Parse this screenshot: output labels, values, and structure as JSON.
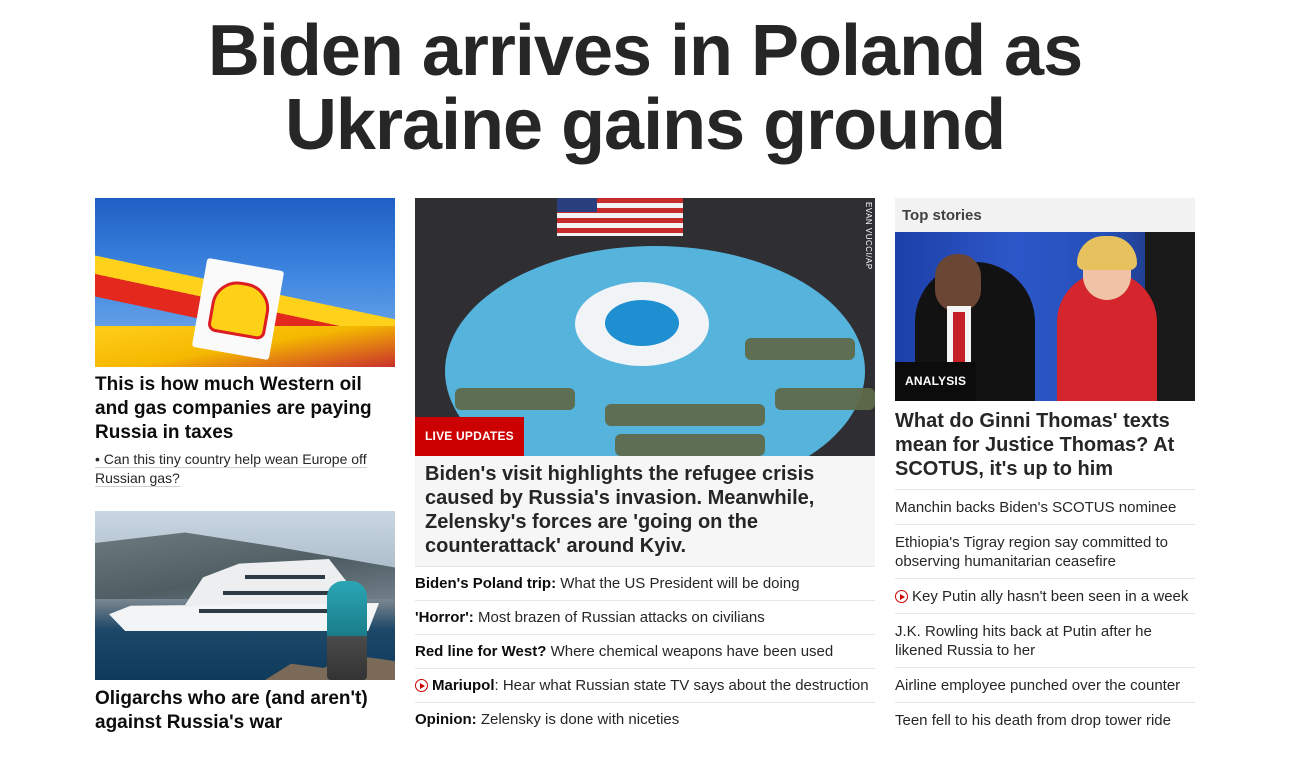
{
  "headline": "Biden arrives in Poland as Ukraine gains ground",
  "left": {
    "story1": {
      "title": "This is how much Western oil and gas companies are paying Russia in taxes",
      "related": "• Can this tiny country help wean Europe off Russian gas?"
    },
    "story2": {
      "title": "Oligarchs who are (and aren't) against Russia's war"
    }
  },
  "middle": {
    "photo_credit": "EVAN VUCCI/AP",
    "label": "LIVE UPDATES",
    "title": "Biden's visit highlights the refugee crisis caused by Russia's invasion. Meanwhile, Zelensky's forces are 'going on the counterattack' around Kyiv.",
    "links": [
      {
        "bold": "Biden's Poland trip:",
        "text": " What the US President will be doing",
        "video": false
      },
      {
        "bold": "'Horror':",
        "text": " Most brazen of Russian attacks on civilians",
        "video": false
      },
      {
        "bold": "Red line for West?",
        "text": " Where chemical weapons have been used",
        "video": false
      },
      {
        "bold": "Mariupol",
        "text": ": Hear what Russian state TV says about the destruction",
        "video": true
      },
      {
        "bold": "Opinion:",
        "text": " Zelensky is done with niceties",
        "video": false
      }
    ]
  },
  "right": {
    "section_title": "Top stories",
    "label": "ANALYSIS",
    "title": "What do Ginni Thomas' texts mean for Justice Thomas? At SCOTUS, it's up to him",
    "links": [
      {
        "text": "Manchin backs Biden's SCOTUS nominee",
        "video": false
      },
      {
        "text": "Ethiopia's Tigray region say committed to observing humanitarian ceasefire",
        "video": false
      },
      {
        "text": "Key Putin ally hasn't been seen in a week",
        "video": true
      },
      {
        "text": "J.K. Rowling hits back at Putin after he likened Russia to her",
        "video": false
      },
      {
        "text": "Airline employee punched over the counter",
        "video": false
      },
      {
        "text": "Teen fell to his death from drop tower ride",
        "video": false
      }
    ]
  },
  "icons": {
    "play": "play-circle-icon"
  },
  "colors": {
    "accent_red": "#cc0000",
    "analysis_black": "#0c0c0c"
  }
}
